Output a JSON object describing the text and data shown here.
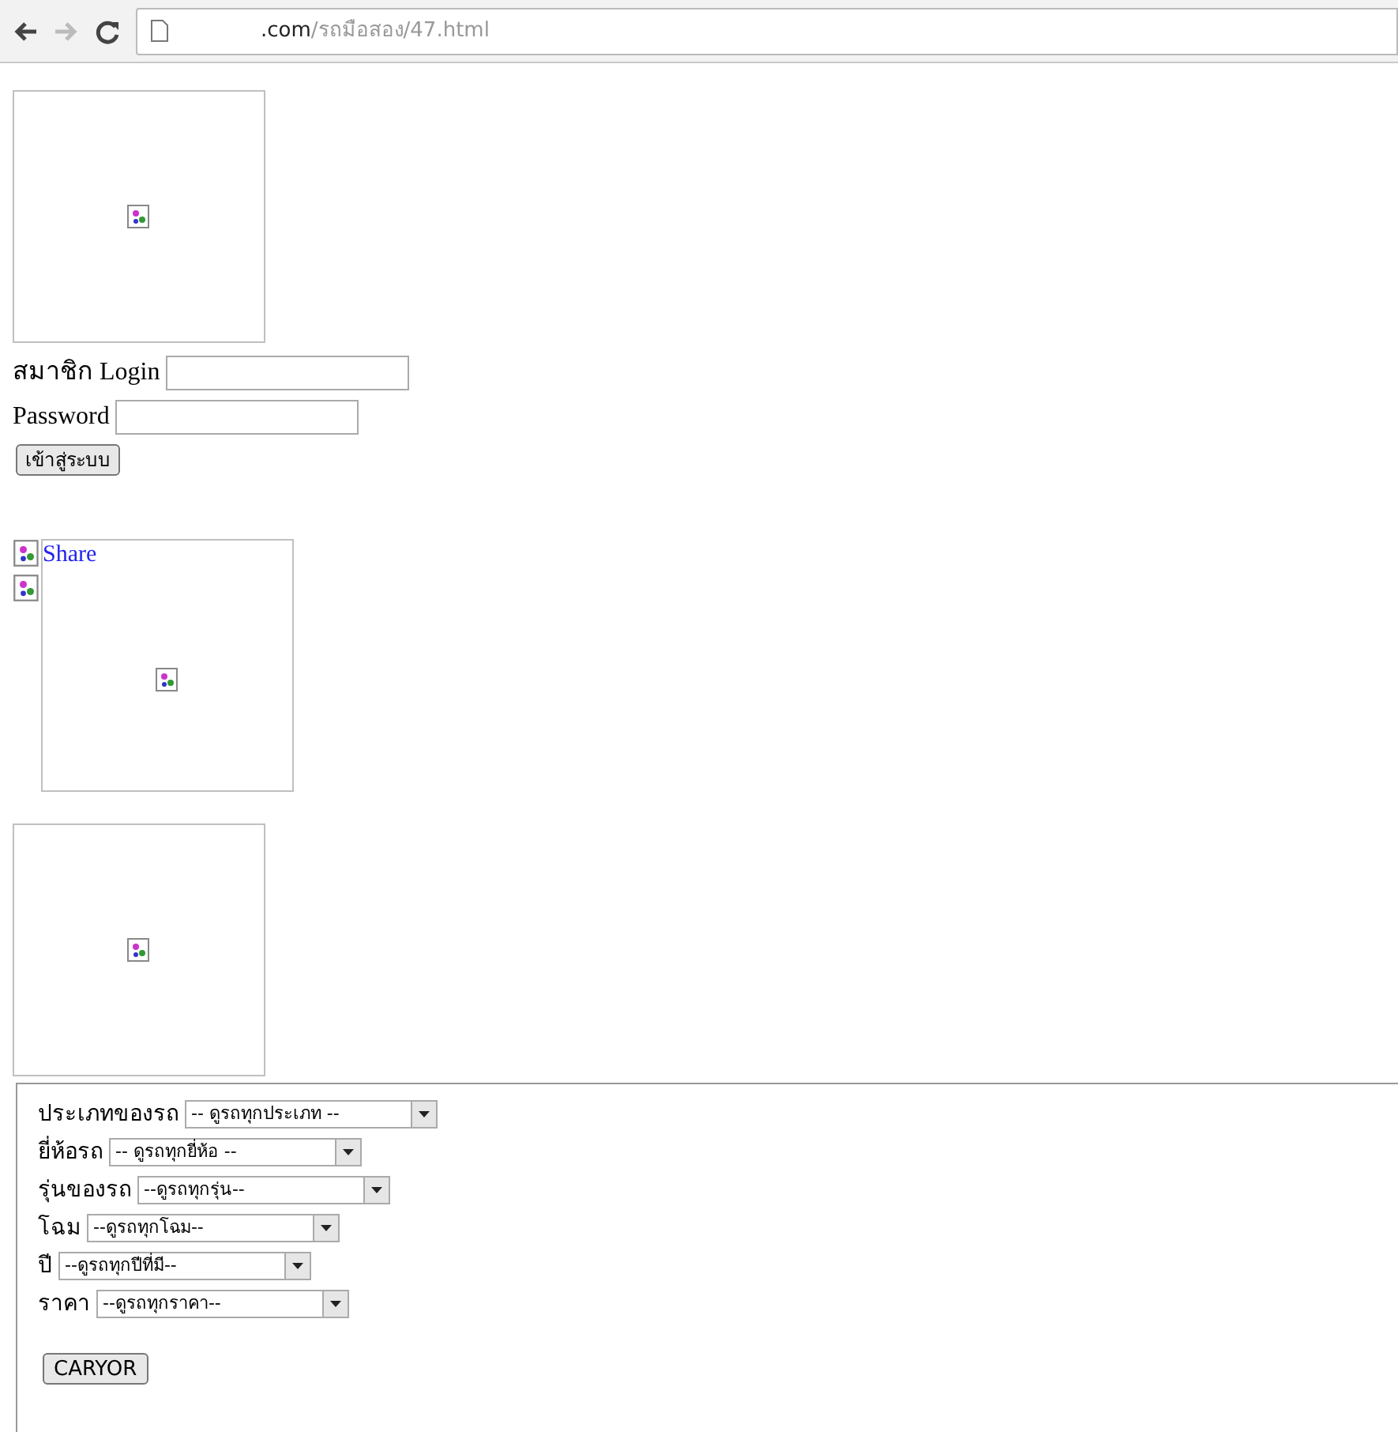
{
  "browser": {
    "url_host": ".com",
    "url_path": "/รถมือสอง/47.html"
  },
  "login": {
    "username_label": "สมาชิก Login",
    "password_label": "Password",
    "submit": "เข้าสู่ระบบ"
  },
  "share": {
    "link": "Share"
  },
  "filters": [
    {
      "label": "ประเภทของรถ",
      "value": "-- ดูรถทุกประเภท --"
    },
    {
      "label": "ยี่ห้อรถ",
      "value": "-- ดูรถทุกยี่ห้อ --"
    },
    {
      "label": "รุ่นของรถ",
      "value": "--ดูรถทุกรุ่น--"
    },
    {
      "label": "โฉม",
      "value": "--ดูรถทุกโฉม--"
    },
    {
      "label": "ปี",
      "value": "--ดูรถทุกปีที่มี--"
    },
    {
      "label": "ราคา",
      "value": "--ดูรถทุกราคา--"
    }
  ],
  "search_button": "CARYOR"
}
